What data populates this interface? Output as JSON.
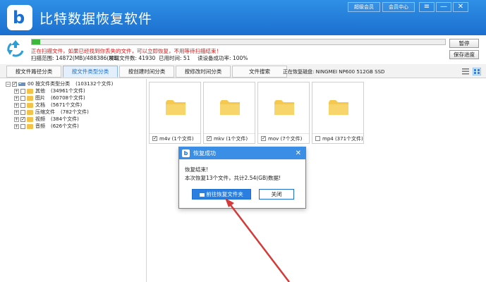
{
  "app": {
    "title": "比特数据恢复软件",
    "logo_letter": "b",
    "buttons": {
      "vip": "超级会员",
      "member": "会员中心"
    },
    "window_controls": {
      "menu": "≡",
      "minimize": "—",
      "close": "✕"
    }
  },
  "scan": {
    "progress": 0.02,
    "message": "正在扫描文件，如果已经找到你丢失的文件，可以立即恢复，不用等待扫描结束！",
    "range_label": "扫描范围:",
    "range_value": "14872(MB)/488386(MB)",
    "found_label": "发现文件数:",
    "found_value": "41930",
    "elapsed_label": "已用时间:",
    "elapsed_value": "51",
    "success_label": "读设备成功率:",
    "success_value": "100%",
    "pause": "暂停",
    "save": "保存进度"
  },
  "tabs": [
    {
      "label": "按文件路径分类"
    },
    {
      "label": "按文件类型分类"
    },
    {
      "label": "按创建时间分类"
    },
    {
      "label": "按修改时间分类"
    },
    {
      "label": "文件搜索"
    }
  ],
  "disk": "正在恢复磁盘: NINGMEI NP600 512GB SSD",
  "tree": {
    "root": {
      "label": "00 按文件类型分类",
      "count": "(103132个文件)"
    },
    "items": [
      {
        "label": "其他",
        "count": "(34961个文件)"
      },
      {
        "label": "图片",
        "count": "(60708个文件)"
      },
      {
        "label": "文档",
        "count": "(5671个文件)"
      },
      {
        "label": "压缩文件",
        "count": "(782个文件)"
      },
      {
        "label": "视频",
        "count": "(384个文件)"
      },
      {
        "label": "音频",
        "count": "(626个文件)"
      }
    ]
  },
  "grid": {
    "items": [
      {
        "label": "m4v (1个文件)"
      },
      {
        "label": "mkv (1个文件)"
      },
      {
        "label": "mov (7个文件)"
      },
      {
        "label": "mp4 (371个文件)"
      }
    ]
  },
  "dialog": {
    "title": "恢复成功",
    "line1": "恢复结束!",
    "line2": "本次恢复13个文件，共计2.54(GB)数据!",
    "open_folder": "前往恢复文件夹",
    "close": "关闭"
  },
  "colors": {
    "accent": "#1c6fcf",
    "progress": "#3cb83c",
    "warning": "#d61b1b",
    "arrow": "#d43a3a"
  }
}
